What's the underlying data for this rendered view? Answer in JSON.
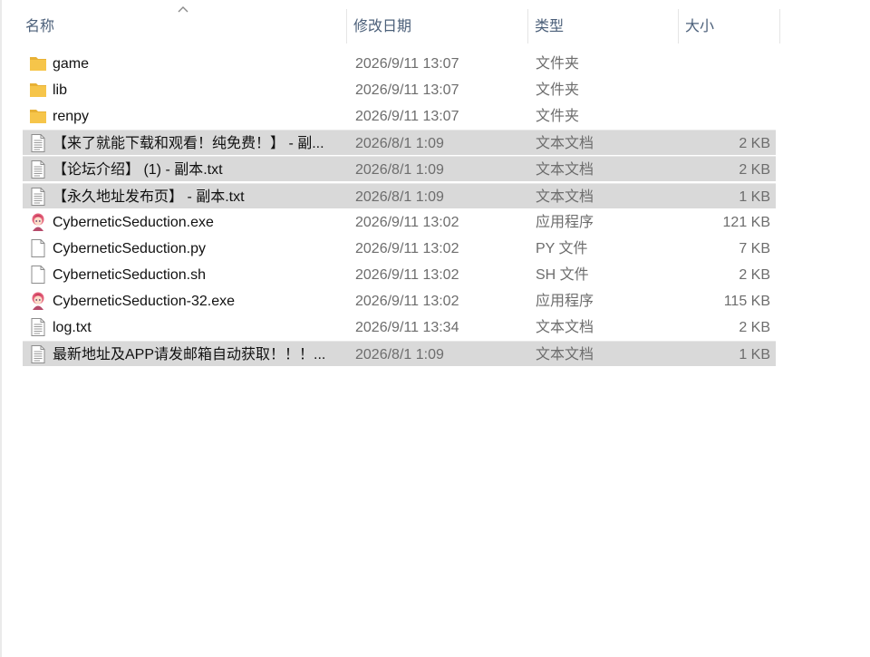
{
  "columns": {
    "name": "名称",
    "date": "修改日期",
    "type": "类型",
    "size": "大小"
  },
  "sort": {
    "column": "name",
    "direction": "ascending"
  },
  "colors": {
    "folder": "#f6c54a",
    "selection": "#d9d9d9",
    "header_text": "#4c607a"
  },
  "files": [
    {
      "name": "game",
      "date": "2026/9/11 13:07",
      "type": "文件夹",
      "size": "",
      "icon": "folder-icon",
      "selected": false
    },
    {
      "name": "lib",
      "date": "2026/9/11 13:07",
      "type": "文件夹",
      "size": "",
      "icon": "folder-icon",
      "selected": false
    },
    {
      "name": "renpy",
      "date": "2026/9/11 13:07",
      "type": "文件夹",
      "size": "",
      "icon": "folder-icon",
      "selected": false
    },
    {
      "name": "【来了就能下载和观看！纯免费！】 - 副...",
      "date": "2026/8/1 1:09",
      "type": "文本文档",
      "size": "2 KB",
      "icon": "text-document-icon",
      "selected": true
    },
    {
      "name": "【论坛介绍】 (1) - 副本.txt",
      "date": "2026/8/1 1:09",
      "type": "文本文档",
      "size": "2 KB",
      "icon": "text-document-icon",
      "selected": true
    },
    {
      "name": "【永久地址发布页】 - 副本.txt",
      "date": "2026/8/1 1:09",
      "type": "文本文档",
      "size": "1 KB",
      "icon": "text-document-icon",
      "selected": true
    },
    {
      "name": "CyberneticSeduction.exe",
      "date": "2026/9/11 13:02",
      "type": "应用程序",
      "size": "121 KB",
      "icon": "renpy-app-icon",
      "selected": false
    },
    {
      "name": "CyberneticSeduction.py",
      "date": "2026/9/11 13:02",
      "type": "PY 文件",
      "size": "7 KB",
      "icon": "blank-file-icon",
      "selected": false
    },
    {
      "name": "CyberneticSeduction.sh",
      "date": "2026/9/11 13:02",
      "type": "SH 文件",
      "size": "2 KB",
      "icon": "blank-file-icon",
      "selected": false
    },
    {
      "name": "CyberneticSeduction-32.exe",
      "date": "2026/9/11 13:02",
      "type": "应用程序",
      "size": "115 KB",
      "icon": "renpy-app-icon",
      "selected": false
    },
    {
      "name": "log.txt",
      "date": "2026/9/11 13:34",
      "type": "文本文档",
      "size": "2 KB",
      "icon": "text-document-icon",
      "selected": false
    },
    {
      "name": "最新地址及APP请发邮箱自动获取！！！...",
      "date": "2026/8/1 1:09",
      "type": "文本文档",
      "size": "1 KB",
      "icon": "text-document-icon",
      "selected": true
    }
  ]
}
